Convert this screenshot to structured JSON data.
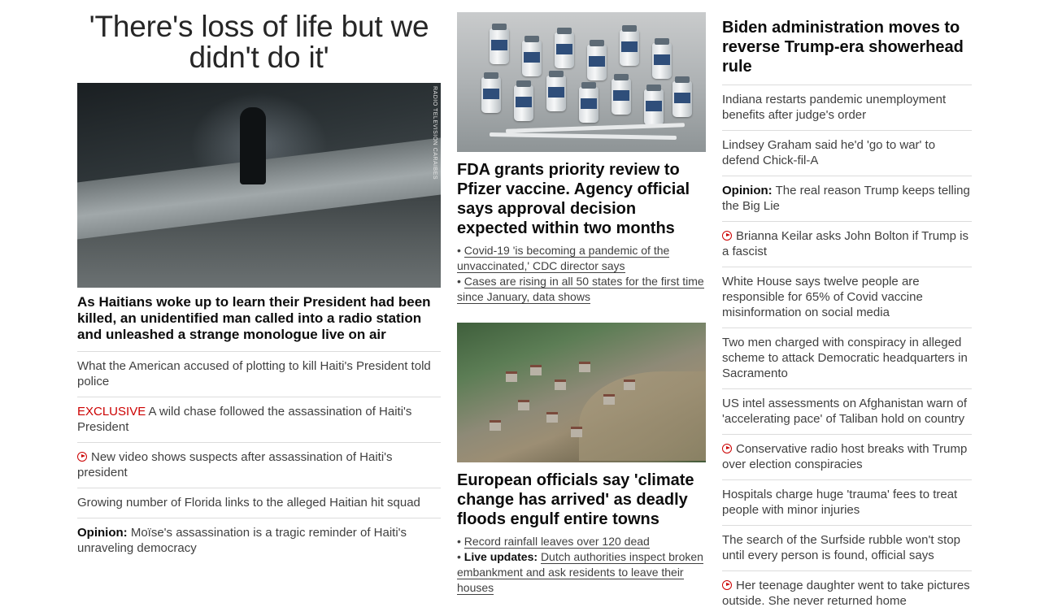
{
  "col1": {
    "hero_title": "'There's loss of life but we didn't do it'",
    "image_credit": "RADIO TELEVISION CARAIBES",
    "lead": "As Haitians woke up to learn their President had been killed, an unidentified man called into a radio station and unleashed a strange monologue live on air",
    "items": [
      {
        "text": "What the American accused of plotting to kill Haiti's President told police"
      },
      {
        "prefix": "EXCLUSIVE",
        "text": "A wild chase followed the assassination of Haiti's President"
      },
      {
        "icon": "play-icon",
        "text": "New video shows suspects after assassination of Haiti's president"
      },
      {
        "text": "Growing number of Florida links to the alleged Haitian hit squad"
      },
      {
        "prefix": "Opinion:",
        "text": "Moïse's assassination is a tragic reminder of Haiti's unraveling democracy"
      }
    ]
  },
  "col2": {
    "story1": {
      "headline": "FDA grants priority review to Pfizer vaccine. Agency official says approval decision expected within two months",
      "bullets": [
        {
          "text": "Covid-19 'is becoming a pandemic of the unvaccinated,' CDC director says"
        },
        {
          "text": "Cases are rising in all 50 states for the first time since January, data shows"
        }
      ]
    },
    "story2": {
      "headline": "European officials say 'climate change has arrived' as deadly floods engulf entire towns",
      "bullets": [
        {
          "text": "Record rainfall leaves over 120 dead"
        },
        {
          "prefix": "Live updates:",
          "text": "Dutch authorities inspect broken embankment and ask residents to leave their houses"
        }
      ]
    }
  },
  "col3": {
    "headline": "Biden administration moves to reverse Trump-era showerhead rule",
    "items": [
      {
        "text": "Indiana restarts pandemic unemployment benefits after judge's order"
      },
      {
        "text": "Lindsey Graham said he'd 'go to war' to defend Chick-fil-A"
      },
      {
        "prefix": "Opinion:",
        "text": "The real reason Trump keeps telling the Big Lie"
      },
      {
        "icon": "play-icon",
        "text": "Brianna Keilar asks John Bolton if Trump is a fascist"
      },
      {
        "text": "White House says twelve people are responsible for 65% of Covid vaccine misinformation on social media"
      },
      {
        "text": "Two men charged with conspiracy in alleged scheme to attack Democratic headquarters in Sacramento"
      },
      {
        "text": "US intel assessments on Afghanistan warn of 'accelerating pace' of Taliban hold on country"
      },
      {
        "icon": "play-icon",
        "text": "Conservative radio host breaks with Trump over election conspiracies"
      },
      {
        "text": "Hospitals charge huge 'trauma' fees to treat people with minor injuries"
      },
      {
        "text": "The search of the Surfside rubble won't stop until every person is found, official says"
      },
      {
        "icon": "play-icon",
        "text": "Her teenage daughter went to take pictures outside. She never returned home"
      }
    ]
  },
  "colors": {
    "accent_red": "#cc0000",
    "text_dark": "#0c0c0c",
    "text_body": "#404040",
    "divider": "#dcdcdc"
  }
}
